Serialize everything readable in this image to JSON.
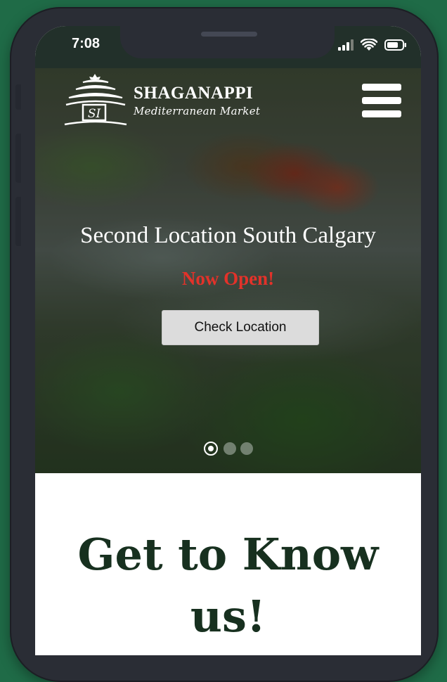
{
  "status_bar": {
    "time": "7:08"
  },
  "header": {
    "logo_name": "SHAGANAPPI",
    "logo_subtitle": "Mediterranean Market",
    "menu_icon": "hamburger-menu-icon"
  },
  "hero": {
    "title": "Second Location South Calgary",
    "subtitle": "Now Open!",
    "button_label": "Check Location",
    "slides_count": 3,
    "active_slide": 1
  },
  "about": {
    "heading": "Get to Know us!"
  },
  "colors": {
    "background": "#1f6b47",
    "phone_frame": "#2a2d35",
    "now_open": "#e3322a",
    "heading": "#17301f",
    "button_bg": "#dcdcdc"
  }
}
